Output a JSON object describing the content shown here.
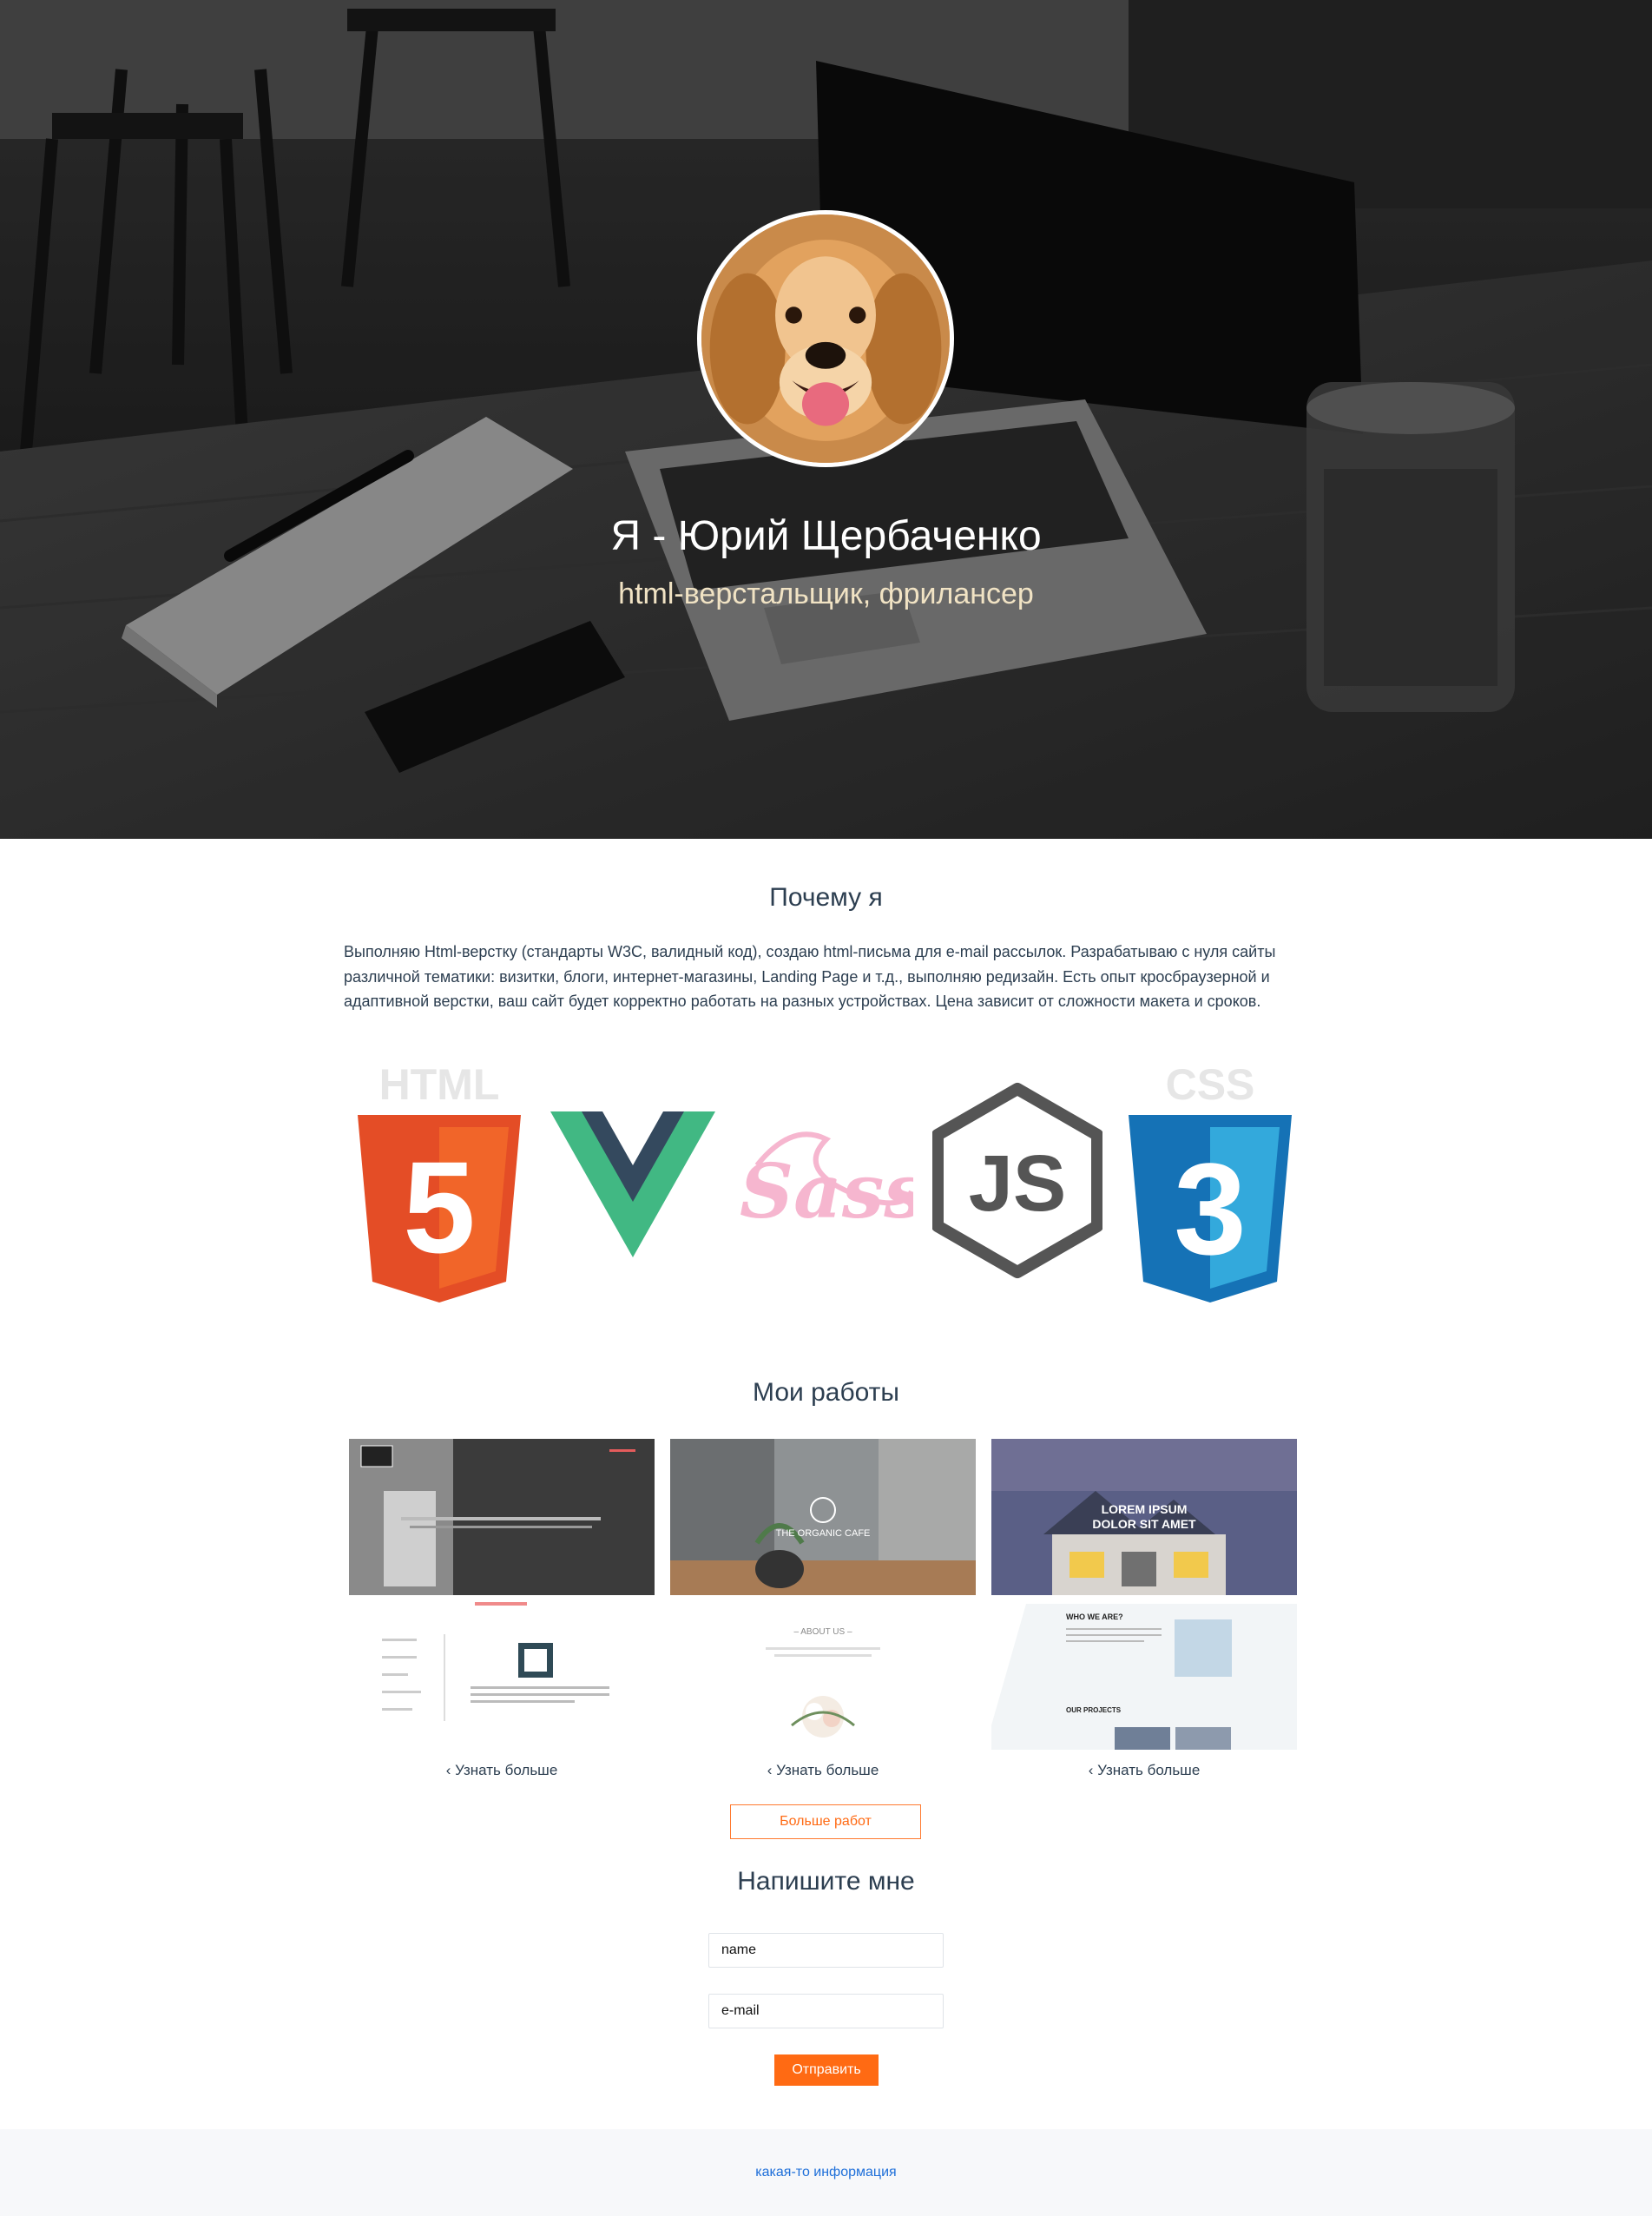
{
  "hero": {
    "title": "Я - Юрий Щербаченко",
    "subtitle": "html-верстальщик, фрилансер"
  },
  "about": {
    "title": "Почему я",
    "text": "Выполняю Html-верстку (стандарты W3C, валидный код), создаю html-письма для e-mail рассылок. Разрабатываю с нуля сайты различной тематики: визитки, блоги, интернет-магазины, Landing Page и т.д., выполняю редизайн. Есть опыт кросбраузерной и адаптивной верстки, ваш сайт будет корректно работать на разных устройствах. Цена зависит от сложности макета и сроков.",
    "logos": {
      "html": "HTML",
      "html_number": "5",
      "css": "CSS",
      "css_number": "3",
      "sass": "Sass",
      "js": "JS"
    }
  },
  "works": {
    "title": "Мои работы",
    "items": [
      {
        "link_label": "Узнать больше",
        "heading": "",
        "subheading": "",
        "caption": ""
      },
      {
        "link_label": "Узнать больше",
        "heading": "THE ORGANIC CAFE",
        "subheading": "",
        "caption": "– ABOUT US –"
      },
      {
        "link_label": "Узнать больше",
        "heading": "LOREM IPSUM",
        "subheading": "DOLOR SIT AMET",
        "caption": "WHO WE ARE?",
        "caption2": "OUR PROJECTS"
      }
    ],
    "more_label": "Больше работ"
  },
  "contact": {
    "title": "Напишите мне",
    "name_placeholder": "name",
    "email_placeholder": "e-mail",
    "submit_label": "Отправить"
  },
  "footer": {
    "text": "какая-то информация"
  },
  "colors": {
    "accent": "#ff6a13",
    "text": "#2c3e50",
    "link": "#1e6fd9",
    "html_orange": "#e44d26",
    "css_blue": "#1572b6",
    "vue_green": "#41b883",
    "vue_dark": "#34495e",
    "sass_pink": "#f6b6cf",
    "node_gray": "#555555"
  },
  "icons": {
    "more_link_icon": "chevron-left-icon"
  }
}
